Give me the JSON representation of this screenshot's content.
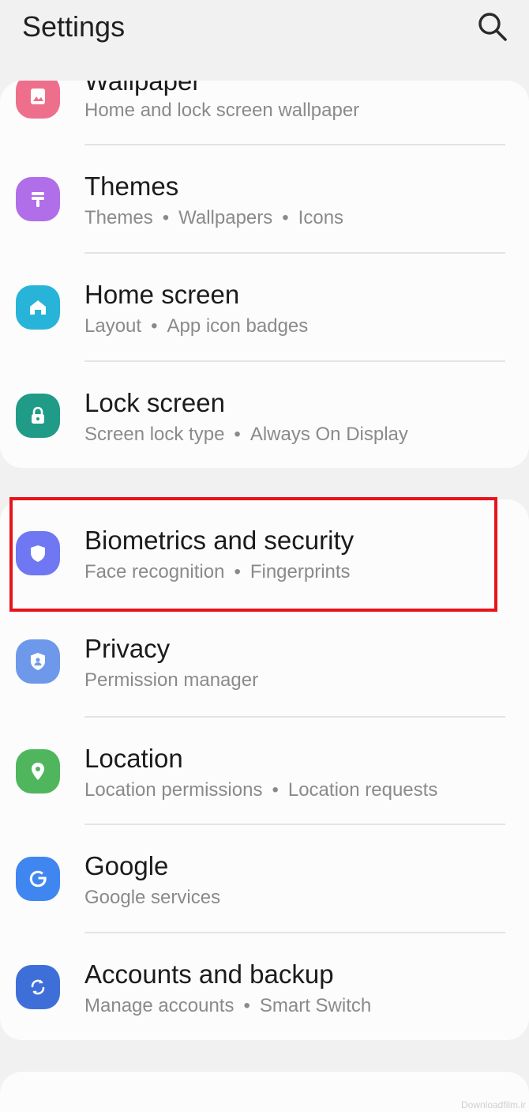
{
  "header": {
    "title": "Settings",
    "search_icon": "search-icon"
  },
  "groups": [
    {
      "items": [
        {
          "id": "wallpaper",
          "label": "Wallpaper",
          "subtitle": [
            "Home and lock screen wallpaper"
          ],
          "icon": "wallpaper-icon",
          "color": "#ee6f8c"
        },
        {
          "id": "themes",
          "label": "Themes",
          "subtitle": [
            "Themes",
            "Wallpapers",
            "Icons"
          ],
          "icon": "themes-icon",
          "color": "#b06ee8"
        },
        {
          "id": "home-screen",
          "label": "Home screen",
          "subtitle": [
            "Layout",
            "App icon badges"
          ],
          "icon": "home-icon",
          "color": "#28b4d8"
        },
        {
          "id": "lock-screen",
          "label": "Lock screen",
          "subtitle": [
            "Screen lock type",
            "Always On Display"
          ],
          "icon": "lock-icon",
          "color": "#1f9b88"
        }
      ]
    },
    {
      "items": [
        {
          "id": "biometrics",
          "label": "Biometrics and security",
          "subtitle": [
            "Face recognition",
            "Fingerprints"
          ],
          "icon": "shield-icon",
          "color": "#6f78f2"
        },
        {
          "id": "privacy",
          "label": "Privacy",
          "subtitle": [
            "Permission manager"
          ],
          "icon": "privacy-icon",
          "color": "#6e99ea"
        },
        {
          "id": "location",
          "label": "Location",
          "subtitle": [
            "Location permissions",
            "Location requests"
          ],
          "icon": "location-pin-icon",
          "color": "#4fb65e"
        },
        {
          "id": "google",
          "label": "Google",
          "subtitle": [
            "Google services"
          ],
          "icon": "google-icon",
          "color": "#3f86f1"
        },
        {
          "id": "accounts",
          "label": "Accounts and backup",
          "subtitle": [
            "Manage accounts",
            "Smart Switch"
          ],
          "icon": "sync-icon",
          "color": "#3e6fd8"
        }
      ]
    }
  ],
  "highlight": {
    "target": "biometrics",
    "color": "#e8141b"
  },
  "watermark": "Downloadfilm.ir"
}
